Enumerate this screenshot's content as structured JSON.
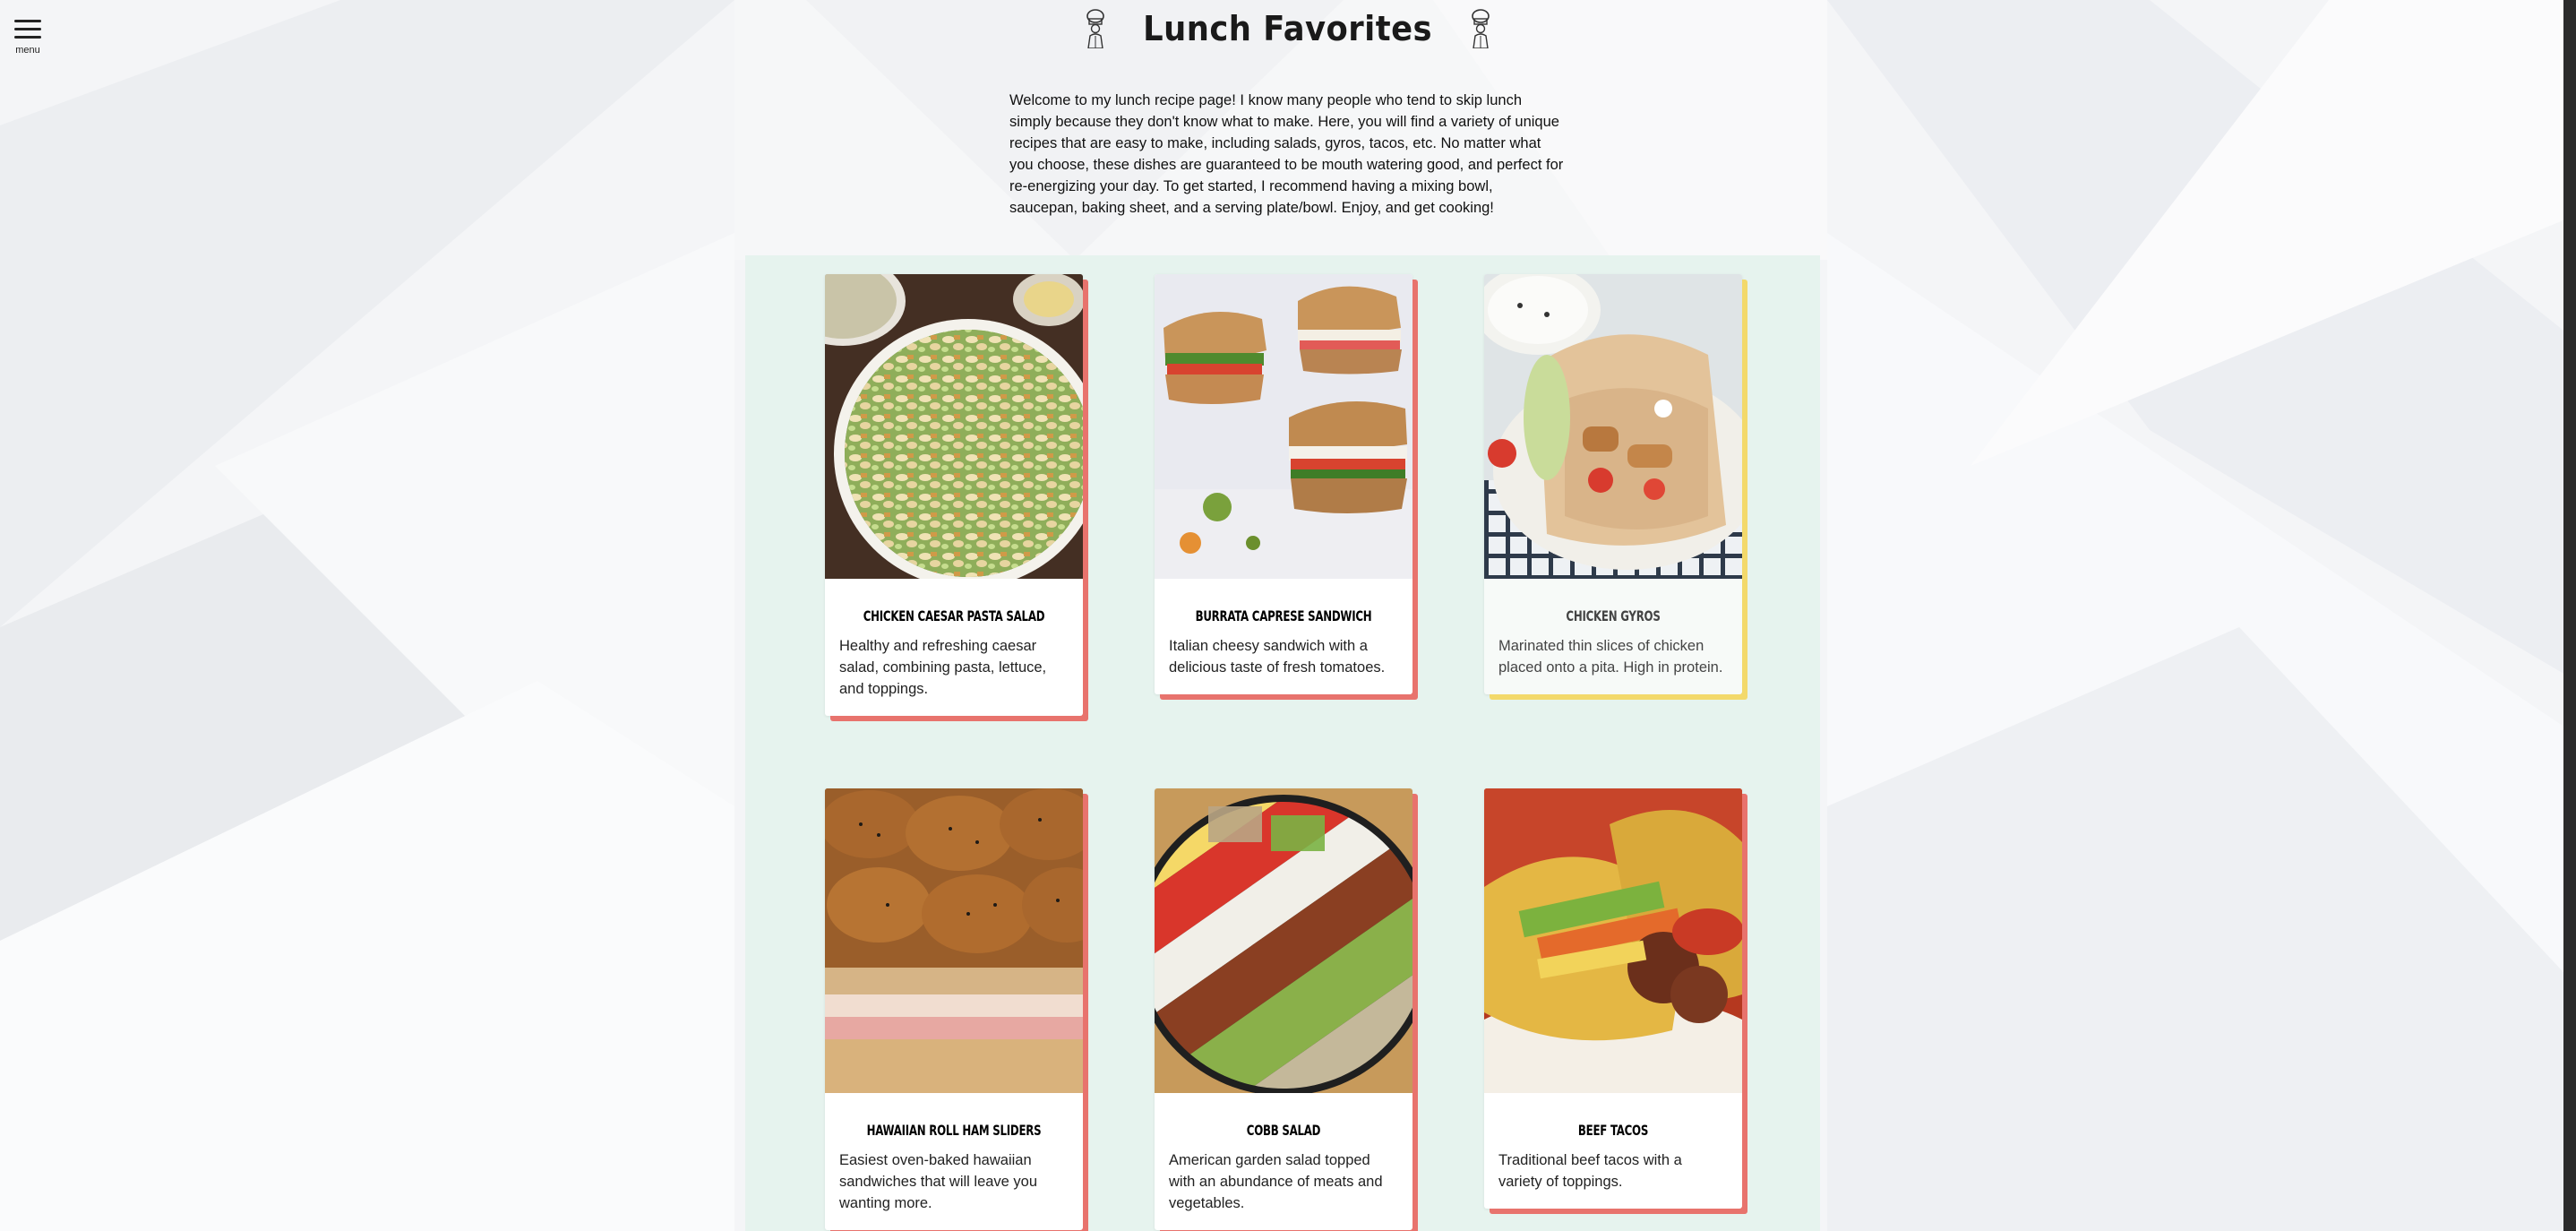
{
  "menu": {
    "label": "menu",
    "icon": "hamburger-icon"
  },
  "page": {
    "title": "Lunch Favorites",
    "title_icon": "chef-icon",
    "intro": "Welcome to my lunch recipe page! I know many people who tend to skip lunch simply because they don't know what to make. Here, you will find a variety of unique recipes that are easy to make, including salads, gyros, tacos, etc. No matter what you choose, these dishes are guaranteed to be mouth watering good, and perfect for re-energizing your day. To get started, I recommend having a mixing bowl, saucepan, baking sheet, and a serving plate/bowl. Enjoy, and get cooking!"
  },
  "colors": {
    "accent_red": "#e8736d",
    "accent_yellow": "#f3d96b",
    "panel_bg": "#e6f3ee"
  },
  "recipes": [
    {
      "title": "Chicken Caesar Pasta Salad",
      "description": "Healthy and refreshing caesar salad, combining pasta, lettuce, and toppings."
    },
    {
      "title": "Burrata Caprese Sandwich",
      "description": "Italian cheesy sandwich with a delicious taste of fresh tomatoes."
    },
    {
      "title": "Chicken Gyros",
      "description": "Marinated thin slices of chicken placed onto a pita. High in protein."
    },
    {
      "title": "Hawaiian Roll Ham Sliders",
      "description": "Easiest oven-baked hawaiian sandwiches that will leave you wanting more."
    },
    {
      "title": "Cobb Salad",
      "description": "American garden salad topped with an abundance of meats and vegetables."
    },
    {
      "title": "Beef Tacos",
      "description": "Traditional beef tacos with a variety of toppings."
    }
  ]
}
